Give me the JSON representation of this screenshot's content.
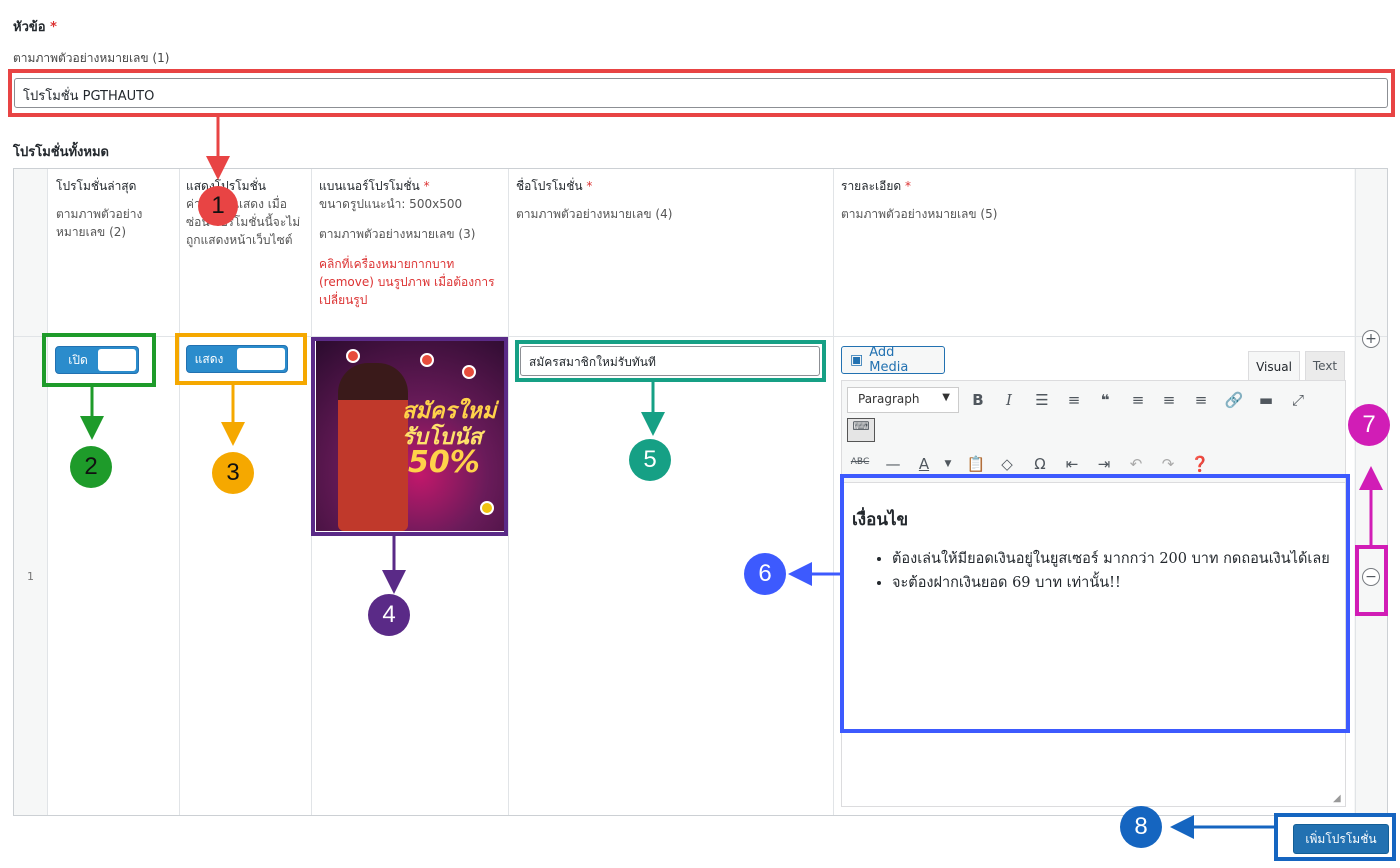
{
  "section": {
    "title_label": "หัวข้อ",
    "required_mark": "*",
    "title_hint": "ตามภาพตัวอย่างหมายเลข (1)",
    "title_value": "โปรโมชั่น PGTHAUTO"
  },
  "table": {
    "label": "โปรโมชั่นทั้งหมด",
    "row_number": "1",
    "headers": {
      "latest": {
        "title": "โปรโมชั่นล่าสุด",
        "hint": "ตามภาพตัวอย่างหมายเลข (2)"
      },
      "show": {
        "title": "แสดงโปรโมชั่น",
        "hint": "ค่าเริ่มต้นแสดง เมื่อซ่อน โปรโมชั่นนี้จะไม่ถูกแสดงหน้าเว็บไซต์"
      },
      "banner": {
        "title": "แบนเนอร์โปรโมชั่น",
        "size": "ขนาดรูปแนะนำ: 500x500",
        "hint": "ตามภาพตัวอย่างหมายเลข (3)",
        "warn": "คลิกที่เครื่องหมายกากบาท (remove) บนรูปภาพ เมื่อต้องการเปลี่ยนรูป"
      },
      "name": {
        "title": "ชื่อโปรโมชั่น",
        "hint": "ตามภาพตัวอย่างหมายเลข (4)"
      },
      "detail": {
        "title": "รายละเอียด",
        "hint": "ตามภาพตัวอย่างหมายเลข (5)"
      }
    },
    "row": {
      "toggle_latest": "เปิด",
      "toggle_show": "แสดง",
      "banner_text": [
        "สมัครใหม่",
        "รับโบนัส",
        "50%"
      ],
      "promo_name": "สมัครสมาชิกใหม่รับทันที",
      "editor": {
        "add_media": "Add Media",
        "tab_visual": "Visual",
        "tab_text": "Text",
        "format": "Paragraph",
        "heading": "เงื่อนไข",
        "items": [
          "ต้องเล่นให้มียอดเงินอยู่ในยูสเซอร์ มากกว่า 200 บาท กดถอนเงินได้เลย",
          "จะต้องฝากเงินยอด 69 บาท เท่านั้น!!"
        ]
      }
    },
    "add_button": "เพิ่มโปรโมชั่น"
  },
  "annotations": {
    "numbers": [
      "1",
      "2",
      "3",
      "4",
      "5",
      "6",
      "7",
      "8"
    ],
    "colors": {
      "1": "#e84444",
      "2": "#1e9b2a",
      "3": "#f5a800",
      "4": "#5a2a87",
      "5": "#16a085",
      "6": "#3d5afe",
      "7": "#d11db6",
      "8": "#1565c0"
    }
  }
}
